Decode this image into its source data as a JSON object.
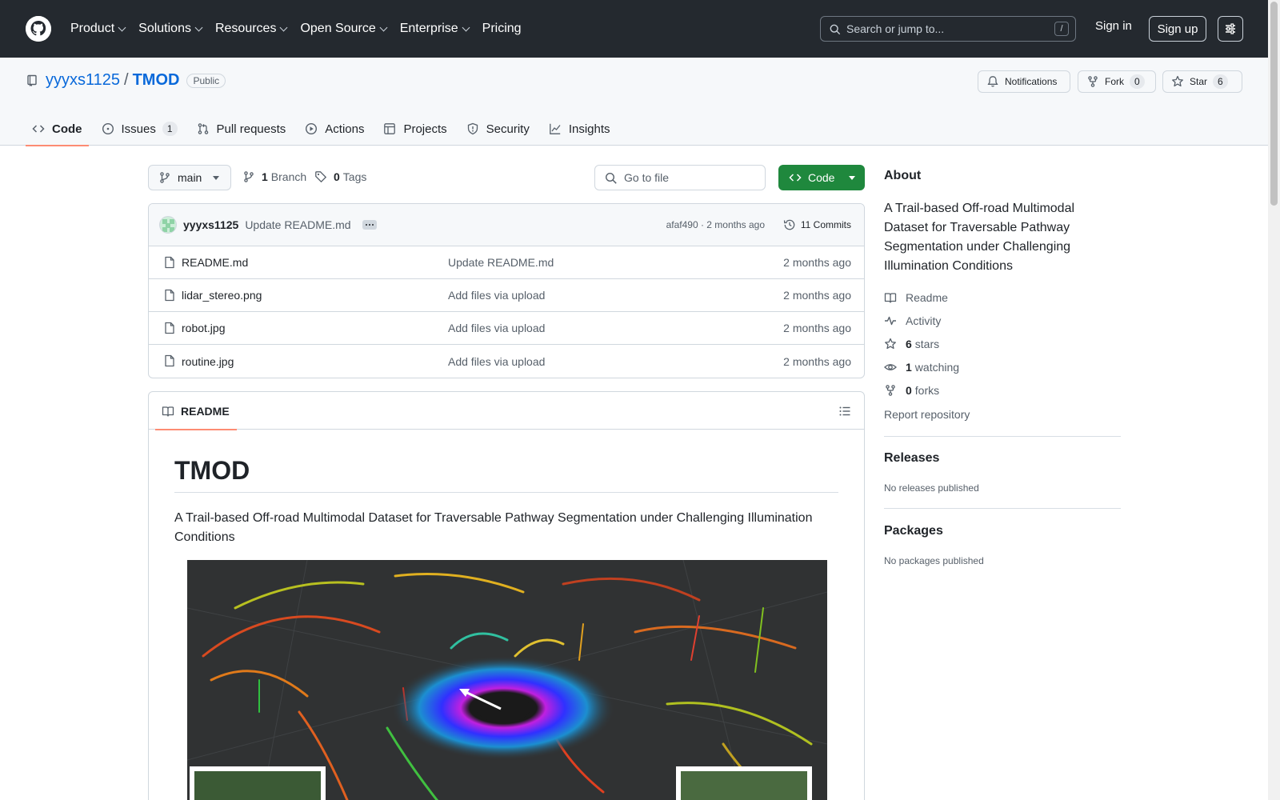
{
  "header": {
    "nav": [
      {
        "label": "Product",
        "dropdown": true
      },
      {
        "label": "Solutions",
        "dropdown": true
      },
      {
        "label": "Resources",
        "dropdown": true
      },
      {
        "label": "Open Source",
        "dropdown": true
      },
      {
        "label": "Enterprise",
        "dropdown": true
      },
      {
        "label": "Pricing",
        "dropdown": false
      }
    ],
    "search_placeholder": "Search or jump to...",
    "search_shortcut": "/",
    "signin_label": "Sign in",
    "signup_label": "Sign up"
  },
  "repo": {
    "owner": "yyyxs1125",
    "separator": "/",
    "name": "TMOD",
    "visibility": "Public",
    "notifications_label": "Notifications",
    "fork_label": "Fork",
    "fork_count": "0",
    "star_label": "Star",
    "star_count": "6"
  },
  "tabs": [
    {
      "label": "Code",
      "active": true,
      "icon": "code-icon"
    },
    {
      "label": "Issues",
      "count": "1",
      "icon": "issue-icon"
    },
    {
      "label": "Pull requests",
      "icon": "pull-request-icon"
    },
    {
      "label": "Actions",
      "icon": "play-icon"
    },
    {
      "label": "Projects",
      "icon": "table-icon"
    },
    {
      "label": "Security",
      "icon": "shield-icon"
    },
    {
      "label": "Insights",
      "icon": "graph-icon"
    }
  ],
  "branch_bar": {
    "branch": "main",
    "branch_count": "1",
    "branch_label": "Branch",
    "tag_count": "0",
    "tag_label": "Tags",
    "goto_placeholder": "Go to file",
    "code_label": "Code"
  },
  "latest_commit": {
    "author": "yyyxs1125",
    "message": "Update README.md",
    "hash_time": "afaf490 · 2 months ago",
    "commits_label": "11 Commits"
  },
  "files": [
    {
      "name": "README.md",
      "message": "Update README.md",
      "date": "2 months ago"
    },
    {
      "name": "lidar_stereo.png",
      "message": "Add files via upload",
      "date": "2 months ago"
    },
    {
      "name": "robot.jpg",
      "message": "Add files via upload",
      "date": "2 months ago"
    },
    {
      "name": "routine.jpg",
      "message": "Add files via upload",
      "date": "2 months ago"
    }
  ],
  "readme": {
    "tab_label": "README",
    "title": "TMOD",
    "paragraph": "A Trail-based Off-road Multimodal Dataset for Traversable Pathway Segmentation under Challenging Illumination Conditions"
  },
  "sidebar": {
    "about_heading": "About",
    "description": "A Trail-based Off-road Multimodal Dataset for Traversable Pathway Segmentation under Challenging Illumination Conditions",
    "readme_label": "Readme",
    "activity_label": "Activity",
    "stars_count": "6",
    "stars_label": "stars",
    "watching_count": "1",
    "watching_label": "watching",
    "forks_count": "0",
    "forks_label": "forks",
    "report_label": "Report repository",
    "releases_heading": "Releases",
    "releases_text": "No releases published",
    "packages_heading": "Packages",
    "packages_text": "No packages published"
  },
  "colors": {
    "header_bg": "#24292f",
    "link": "#0969da",
    "code_button": "#1f883d",
    "active_tab_underline": "#fd8c73"
  }
}
